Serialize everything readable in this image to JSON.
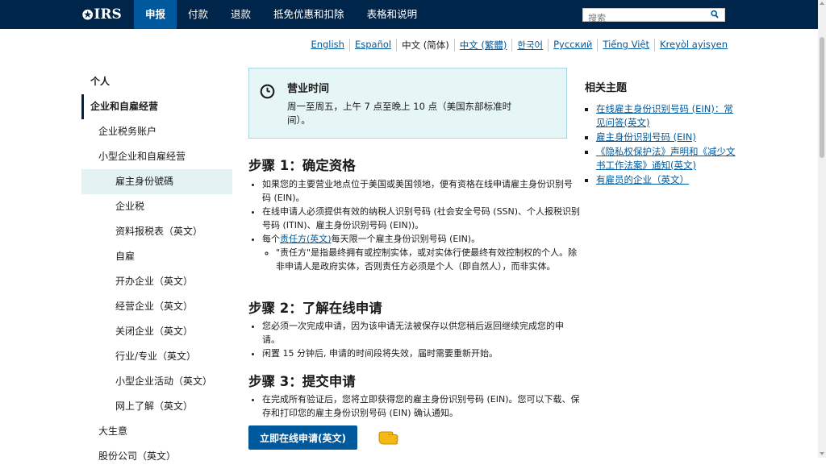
{
  "header": {
    "logo_text": "IRS",
    "nav": [
      "申报",
      "付款",
      "退款",
      "抵免优惠和扣除",
      "表格和说明"
    ],
    "search_placeholder": "搜索"
  },
  "languages": [
    "English",
    "Español",
    "中文 (简体)",
    "中文 (繁體)",
    "한국어",
    "Русский",
    "Tiếng Việt",
    "Kreyòl ayisyen"
  ],
  "sidebar": {
    "items": [
      "个人",
      "企业和自雇经营",
      "企业税务账户",
      "小型企业和自雇经营",
      "雇主身份號碼",
      "企业税",
      "资料报税表（英文）",
      "自雇",
      "开办企业（英文）",
      "经营企业（英文）",
      "关闭企业（英文）",
      "行业/专业（英文）",
      "小型企业活动（英文）",
      "网上了解（英文）",
      "大生意",
      "股份公司（英文）"
    ]
  },
  "alert": {
    "title": "营业时间",
    "text": "周一至周五，上午 7 点至晚上 10 点（美国东部标准时间）。"
  },
  "steps": [
    {
      "heading": "步骤 1：确定资格",
      "bullets": [
        "如果您的主要营业地点位于美国或美国领地，便有资格在线申请雇主身份识别号码 (EIN)。",
        "在线申请人必须提供有效的纳税人识别号码 (社会安全号码 (SSN)、个人报税识别号码 (ITIN)、雇主身份识别号码 (EIN))。"
      ],
      "bullet3_prefix": "每个",
      "bullet3_link": "责任方(英文)",
      "bullet3_suffix": "每天限一个雇主身份识别号码 (EIN)。",
      "sub_bullet": "\"责任方\"是指最终拥有或控制实体，或对实体行使最终有效控制权的个人。除非申请人是政府实体，否则责任方必须是个人（即自然人），而非实体。"
    },
    {
      "heading": "步骤 2：了解在线申请",
      "bullets": [
        "您必须一次完成申请，因为该申请无法被保存以供您稍后返回继续完成您的申请。",
        "闲置 15 分钟后, 申请的时间段将失效，届时需要重新开始。"
      ]
    },
    {
      "heading": "步骤 3：提交申请",
      "bullets": [
        "在完成所有验证后，您将立即获得您的雇主身份识别号码 (EIN)。您可以下载、保存和打印您的雇主身份识别号码 (EIN) 确认通知。"
      ]
    }
  ],
  "cta_label": "立即在线申请(英文)",
  "related": {
    "title": "相关主题",
    "links": [
      "在线雇主身份识别号码 (EIN)：常见问答(英文)",
      "雇主身份识别号码 (EIN)",
      "《隐私权保护法》声明和《减少文书工作法案》通知(英文)",
      "有雇员的企业（英文）"
    ]
  },
  "colors": {
    "header_bg": "#00254a",
    "nav_active": "#00599c",
    "link": "#00599c",
    "alert_bg": "#e6f6f7",
    "sidebar_highlight": "#e4f2f3"
  }
}
